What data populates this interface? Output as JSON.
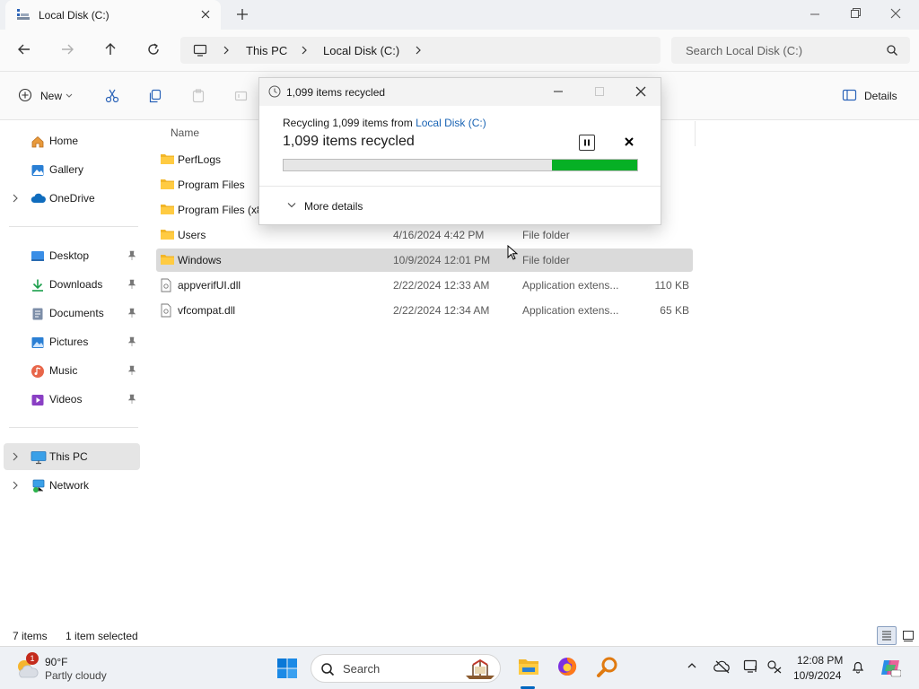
{
  "window": {
    "tab_title": "Local Disk (C:)",
    "new_tab": "+"
  },
  "nav": {
    "breadcrumb": [
      "This PC",
      "Local Disk (C:)"
    ],
    "search_placeholder": "Search Local Disk (C:)"
  },
  "toolbar": {
    "new_label": "New",
    "details_label": "Details"
  },
  "sidebar": {
    "items": [
      {
        "label": "Home",
        "icon": "home-icon"
      },
      {
        "label": "Gallery",
        "icon": "gallery-icon"
      },
      {
        "label": "OneDrive",
        "icon": "cloud-icon"
      },
      {
        "label": "Desktop",
        "icon": "desktop-icon"
      },
      {
        "label": "Downloads",
        "icon": "download-icon"
      },
      {
        "label": "Documents",
        "icon": "document-icon"
      },
      {
        "label": "Pictures",
        "icon": "pictures-icon"
      },
      {
        "label": "Music",
        "icon": "music-icon"
      },
      {
        "label": "Videos",
        "icon": "video-icon"
      },
      {
        "label": "This PC",
        "icon": "pc-icon"
      },
      {
        "label": "Network",
        "icon": "network-icon"
      }
    ]
  },
  "filelist": {
    "header_name": "Name",
    "rows": [
      {
        "name": "PerfLogs",
        "date": "",
        "type": "",
        "size": ""
      },
      {
        "name": "Program Files",
        "date": "",
        "type": "",
        "size": ""
      },
      {
        "name": "Program Files (x8",
        "date": "",
        "type": "",
        "size": ""
      },
      {
        "name": "Users",
        "date": "4/16/2024 4:42 PM",
        "type": "File folder",
        "size": ""
      },
      {
        "name": "Windows",
        "date": "10/9/2024 12:01 PM",
        "type": "File folder",
        "size": ""
      },
      {
        "name": "appverifUI.dll",
        "date": "2/22/2024 12:33 AM",
        "type": "Application extens...",
        "size": "110 KB"
      },
      {
        "name": "vfcompat.dll",
        "date": "2/22/2024 12:34 AM",
        "type": "Application extens...",
        "size": "65 KB"
      }
    ]
  },
  "status": {
    "item_count": "7 items",
    "selected": "1 item selected"
  },
  "dialog": {
    "title": "1,099 items recycled",
    "subtitle_prefix": "Recycling 1,099 items from ",
    "subtitle_link": "Local Disk (C:)",
    "heading": "1,099 items recycled",
    "progress_fraction": 0.24,
    "more_details": "More details",
    "colors": {
      "progress": "#06b025",
      "link": "#1a64b4"
    }
  },
  "taskbar": {
    "weather_temp": "90°F",
    "weather_cond": "Partly cloudy",
    "weather_badge": "1",
    "search_label": "Search",
    "time": "12:08 PM",
    "date": "10/9/2024"
  }
}
